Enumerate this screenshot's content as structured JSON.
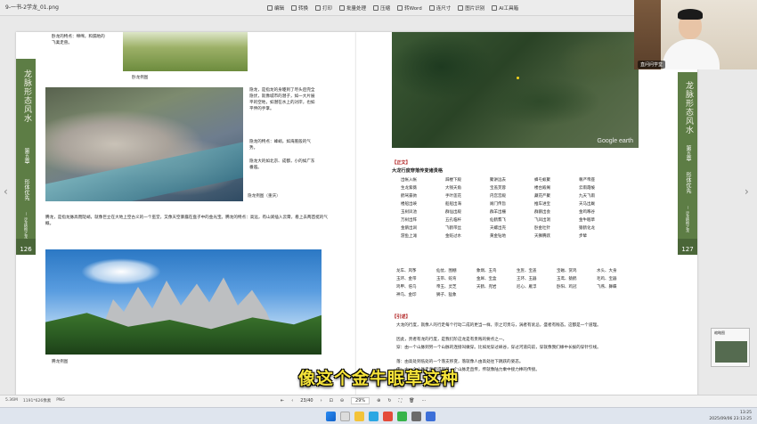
{
  "window": {
    "filename": "9-一书-2学龙_01.png",
    "toolbar": [
      "编辑",
      "转换",
      "打印",
      "批量处理",
      "压缩",
      "转Word",
      "连尺寸",
      "图片识别",
      "AI工具箱"
    ],
    "controls": [
      "—",
      "□",
      "✕"
    ]
  },
  "left_page": {
    "sidebar_title": "龙脉形态风水",
    "sidebar_chapter": "第五章",
    "sidebar_subchapter": "形体优先",
    "sidebar_note": "—  沙龙结构之龙",
    "page_number": "126",
    "top_text": "卧龙的特点：绵绵，和漏地的飞禽走兽。",
    "top_caption": "卧龙例图",
    "hidden_dragon_text": "隐龙，是指龙的身躯到了尽头后完全隐伏，就像城市的潜子，如一大片展平的空地，如潜在水上的对岸，也如平伸的手掌。",
    "hidden_dragon_feat1": "隐龙的特点：峰峭，如海底般的气势。",
    "hidden_dragon_feat2": "隐龙大的如北京、成都，小的如广东番遏。",
    "hidden_caption": "隐龙例图（重庆）",
    "leaping_text": "腾龙，是指龙脉高而陡峭，就像巨立在大地上空古义的一个巫堂，又像天空暴露在盘子中的金光宝。腾龙的特点：高远，有山涧插入云霄，看上去两首挺的气概。",
    "bottom_caption": "腾龙例图"
  },
  "right_page": {
    "sidebar_title": "龙脉形态风水",
    "sidebar_chapter": "第五章",
    "sidebar_subchapter": "形体优先",
    "sidebar_note": "—  沙龙结构之龙",
    "page_number": "127",
    "map_brand": "Google earth",
    "section_label": "【正文】",
    "section_heading": "大龙行度穿落传变诸贵格",
    "terms_block1": [
      "出帐入帐",
      "辞楼下殿",
      "聚讲远去",
      "蜂屯蚁聚",
      "尊严帝座",
      "生龙紫薇",
      "大钱天角",
      "宝盖芙蓉",
      "楼台殿阁",
      "云雨霞帔",
      "鹤驾豪驹",
      "手叶莲花",
      "内宫宫殿",
      "藏花严聚",
      "九天飞雨",
      "楼船出峡",
      "船船出海",
      "阙门传旨",
      "推车进宝",
      "天马出厩",
      "玉树凤池",
      "群仙出殿",
      "群羊出栅",
      "群鹅出会",
      "金鸡啄谷",
      "万树出阵",
      "五孔临杆",
      "仙鹤翥飞",
      "飞凤出洞",
      "金牛眠草",
      "金鹅出涧",
      "飞鹤带丝",
      "天螺出壳",
      "卧金吐针",
      "猿鹤化龙",
      "游鱼上滩",
      "金蛇过水",
      "黄金钻地",
      "天狮腾跃",
      "步辇"
    ],
    "terms_block2": [
      "龙车、风筝",
      "仙仗、围棚",
      "象炯、玉鸟",
      "生旌、宝盖",
      "宝磁、赏鸡",
      "水头、大身",
      "玉环、金带",
      "玉带、蛇弯",
      "金犀、宝盒",
      "王环、玉器",
      "玉鸾、猿鹤",
      "毛鸡、宝器",
      "鸡甲、倍乌",
      "帝玉、灵芝",
      "天鹤、兜岩",
      "尼心、雁浮",
      "卧阳、鸡冠",
      "飞燕、舞蝶",
      "神乌、金印",
      "狮子、猛象"
    ],
    "guide_label": "【引述】",
    "guide_p1": "大龙的行度，就像人的行走每个行动二成的更当一样，宗之可贵与，涡者有讹忌，盛者有贱态。这都是一个道理。",
    "guide_p2": "因此，贵者有龙的行度，是我们阶这龙是有贵贱的要点之一。",
    "guide_p3": "穿：由一个山脉到另一个山脉的连接叫做穿。比如龙穿过峡谷，穿过河道向前，穿就像我们缘中长拔的穿针引线。",
    "guide_p4": "落：由高处到低处的一个落支移变，落就像人由高处往下跳跃的姿态。",
    "guide_p5": "传：由一个山脉走直传得到另一个山脉走直传，传就像陆力乘中接力棒的传接。"
  },
  "webcam": {
    "name_tag": "直问问学堂"
  },
  "subtitle": "像这个金牛眠草这种",
  "statusbar": {
    "left_info": [
      "5.36M",
      "1191*626像素",
      "PNG"
    ],
    "page_indicator": "23/40",
    "zoom": "29%",
    "mini_preview_label": "缩略图"
  },
  "taskbar": {
    "clock_time": "13:25",
    "clock_date": "2025/09/06 23:13:25"
  },
  "colors": {
    "sidebar_green": "#5d7d45",
    "subtitle_yellow": "#f6e43a",
    "heading_red": "#b02020"
  }
}
